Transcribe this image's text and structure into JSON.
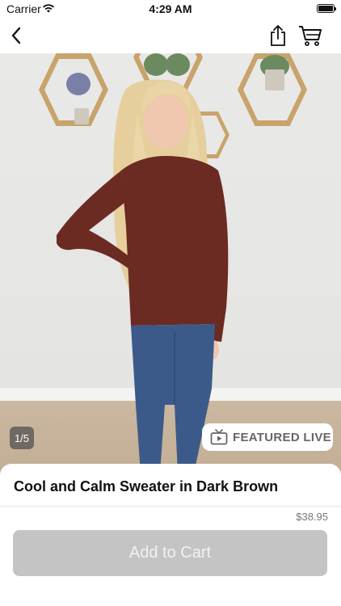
{
  "status_bar": {
    "carrier": "Carrier",
    "time": "4:29 AM"
  },
  "nav": {
    "back_icon": "chevron-left-icon",
    "share_icon": "share-icon",
    "cart_icon": "cart-icon"
  },
  "gallery": {
    "counter": "1/5"
  },
  "featured_badge": {
    "label": "FEATURED LIVE",
    "icon": "tv-play-icon"
  },
  "product": {
    "title": "Cool and Calm Sweater in Dark Brown",
    "price": "$38.95"
  },
  "actions": {
    "add_to_cart_label": "Add to Cart"
  },
  "colors": {
    "button_disabled": "#c4c4c4",
    "sweater": "#6b2a22",
    "jeans": "#3b5a8a"
  }
}
